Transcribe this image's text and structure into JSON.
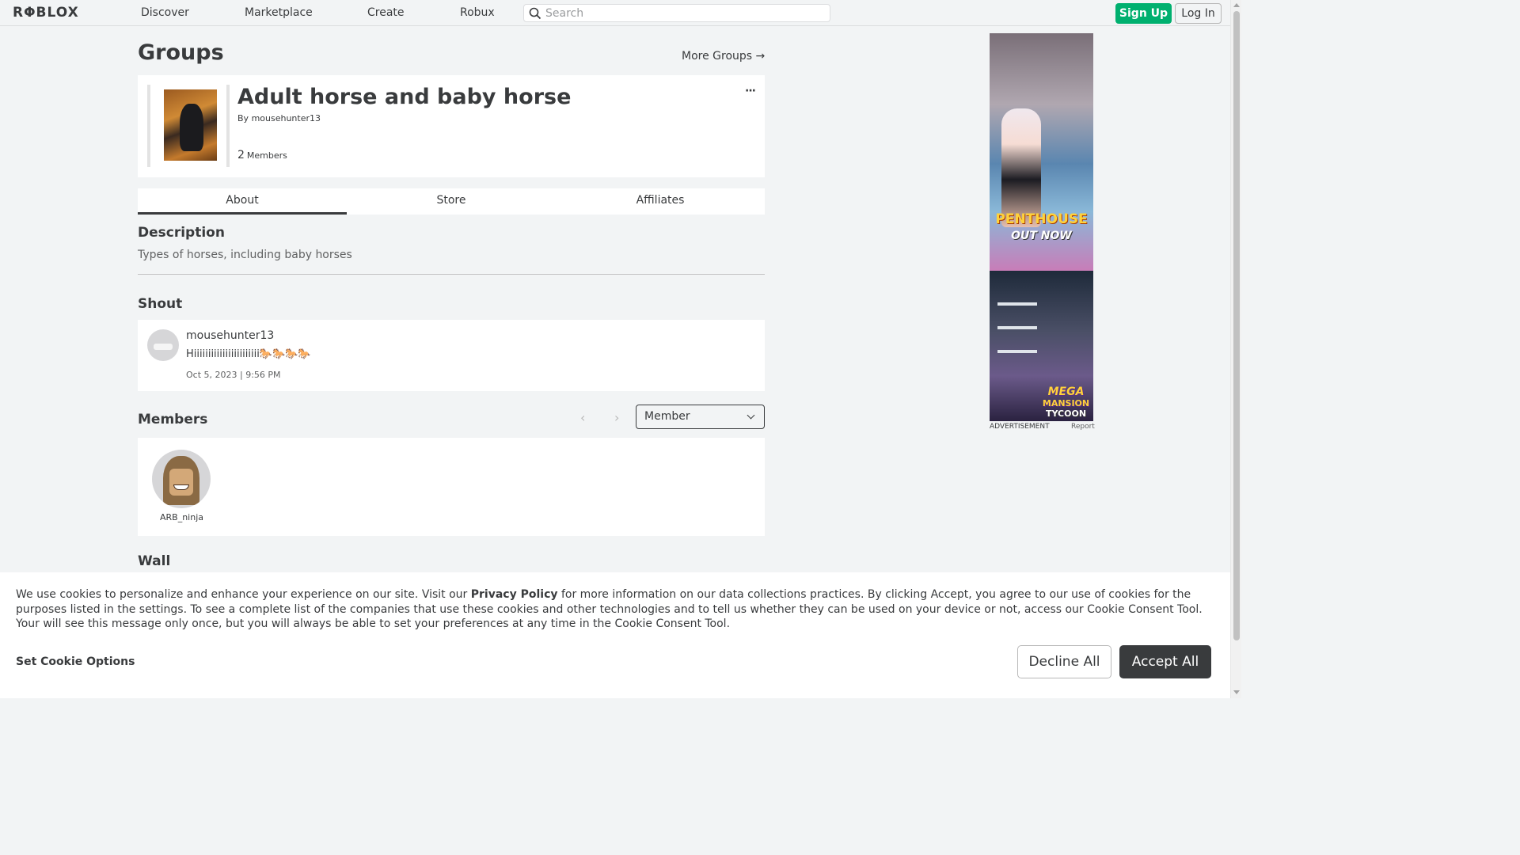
{
  "header": {
    "logo": "RΦBLOX",
    "nav": [
      "Discover",
      "Marketplace",
      "Create",
      "Robux"
    ],
    "search_placeholder": "Search",
    "signup_label": "Sign Up",
    "login_label": "Log In"
  },
  "page": {
    "title": "Groups",
    "more_groups": "More Groups →"
  },
  "group": {
    "name": "Adult horse and baby horse",
    "by_prefix": "By",
    "owner": "mousehunter13",
    "member_count": "2",
    "member_label": "Members",
    "menu": "···"
  },
  "tabs": [
    {
      "label": "About",
      "active": true
    },
    {
      "label": "Store",
      "active": false
    },
    {
      "label": "Affiliates",
      "active": false
    }
  ],
  "about": {
    "description_heading": "Description",
    "description": "Types of horses, including baby horses",
    "shout_heading": "Shout",
    "shout": {
      "user": "mousehunter13",
      "message": "Hiiiiiiiiiiiiiiiiiiiiiii🐎🐎🐎🐎",
      "date": "Oct 5, 2023 | 9:56 PM"
    },
    "members_heading": "Members",
    "role_select": "Member",
    "members": [
      {
        "name": "ARB_ninja"
      }
    ],
    "wall_heading": "Wall"
  },
  "ad": {
    "line1": "PENTHOUSE",
    "line2": "OUT NOW",
    "logo1": "MEGA",
    "logo2": "MANSION",
    "logo3": "TYCOON",
    "label": "ADVERTISEMENT",
    "report": "Report"
  },
  "cookie": {
    "text_before": "We use cookies to personalize and enhance your experience on our site. Visit our ",
    "link": "Privacy Policy",
    "text_after": " for more information on our data collections practices. By clicking Accept, you agree to our use of cookies for the purposes listed in the settings. To see a complete list of the companies that use these cookies and other technologies and to tell us whether they can be used on your device or not, access our Cookie Consent Tool. Your will see this message only once, but you will always be able to set your preferences at any time in the Cookie Consent Tool.",
    "options": "Set Cookie Options",
    "decline": "Decline All",
    "accept": "Accept All"
  },
  "colors": {
    "accent_green": "#00b06f",
    "text_dark": "#393b3d",
    "page_bg": "#f2f4f5"
  }
}
